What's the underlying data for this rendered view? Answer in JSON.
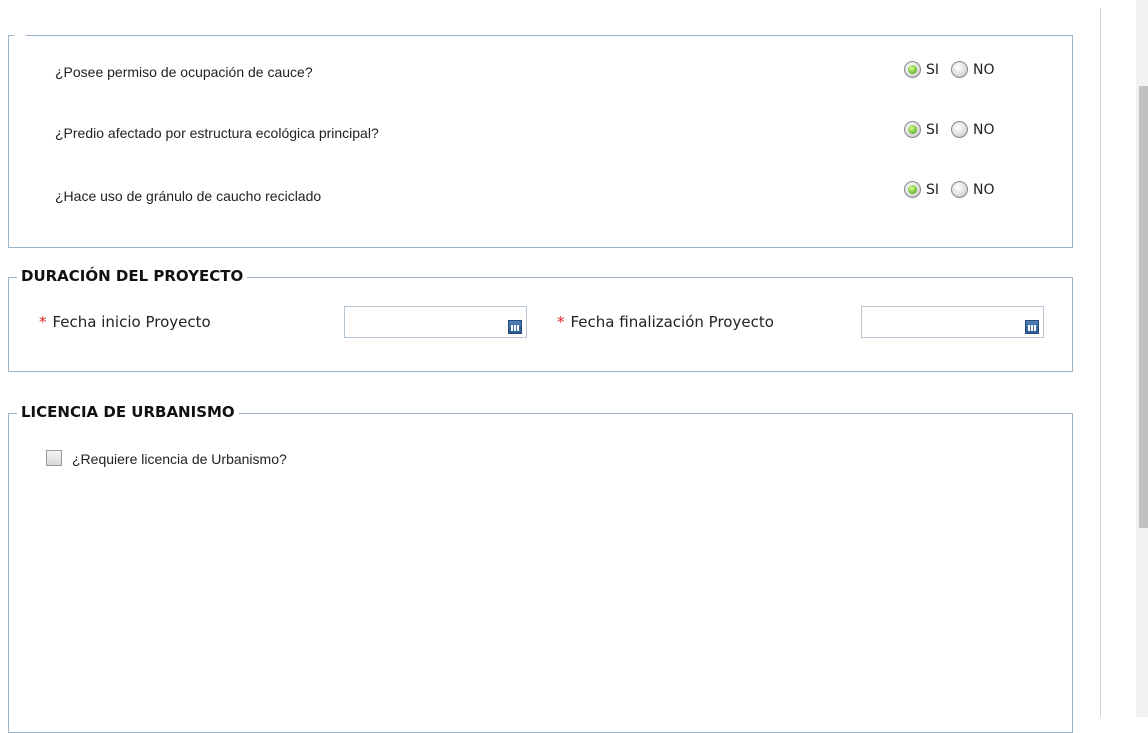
{
  "questions": [
    {
      "label": "¿Posee permiso de ocupación de cauce?",
      "yes": "SI",
      "no": "NO",
      "selected": "SI"
    },
    {
      "label": "¿Predio afectado por estructura ecológica principal?",
      "yes": "SI",
      "no": "NO",
      "selected": "SI"
    },
    {
      "label": "¿Hace uso de gránulo de caucho reciclado",
      "yes": "SI",
      "no": "NO",
      "selected": "SI"
    }
  ],
  "duracion": {
    "legend": "DURACIÓN DEL PROYECTO",
    "required_mark": "*",
    "start_label": "Fecha inicio Proyecto",
    "start_value": "",
    "end_label": "Fecha finalización Proyecto",
    "end_value": ""
  },
  "licencia": {
    "legend": "LICENCIA DE URBANISMO",
    "checkbox_label": "¿Requiere licencia de Urbanismo?",
    "checked": false
  },
  "colors": {
    "border": "#9db3c8",
    "required": "#e02020",
    "radio_selected": "#7ec63a"
  }
}
